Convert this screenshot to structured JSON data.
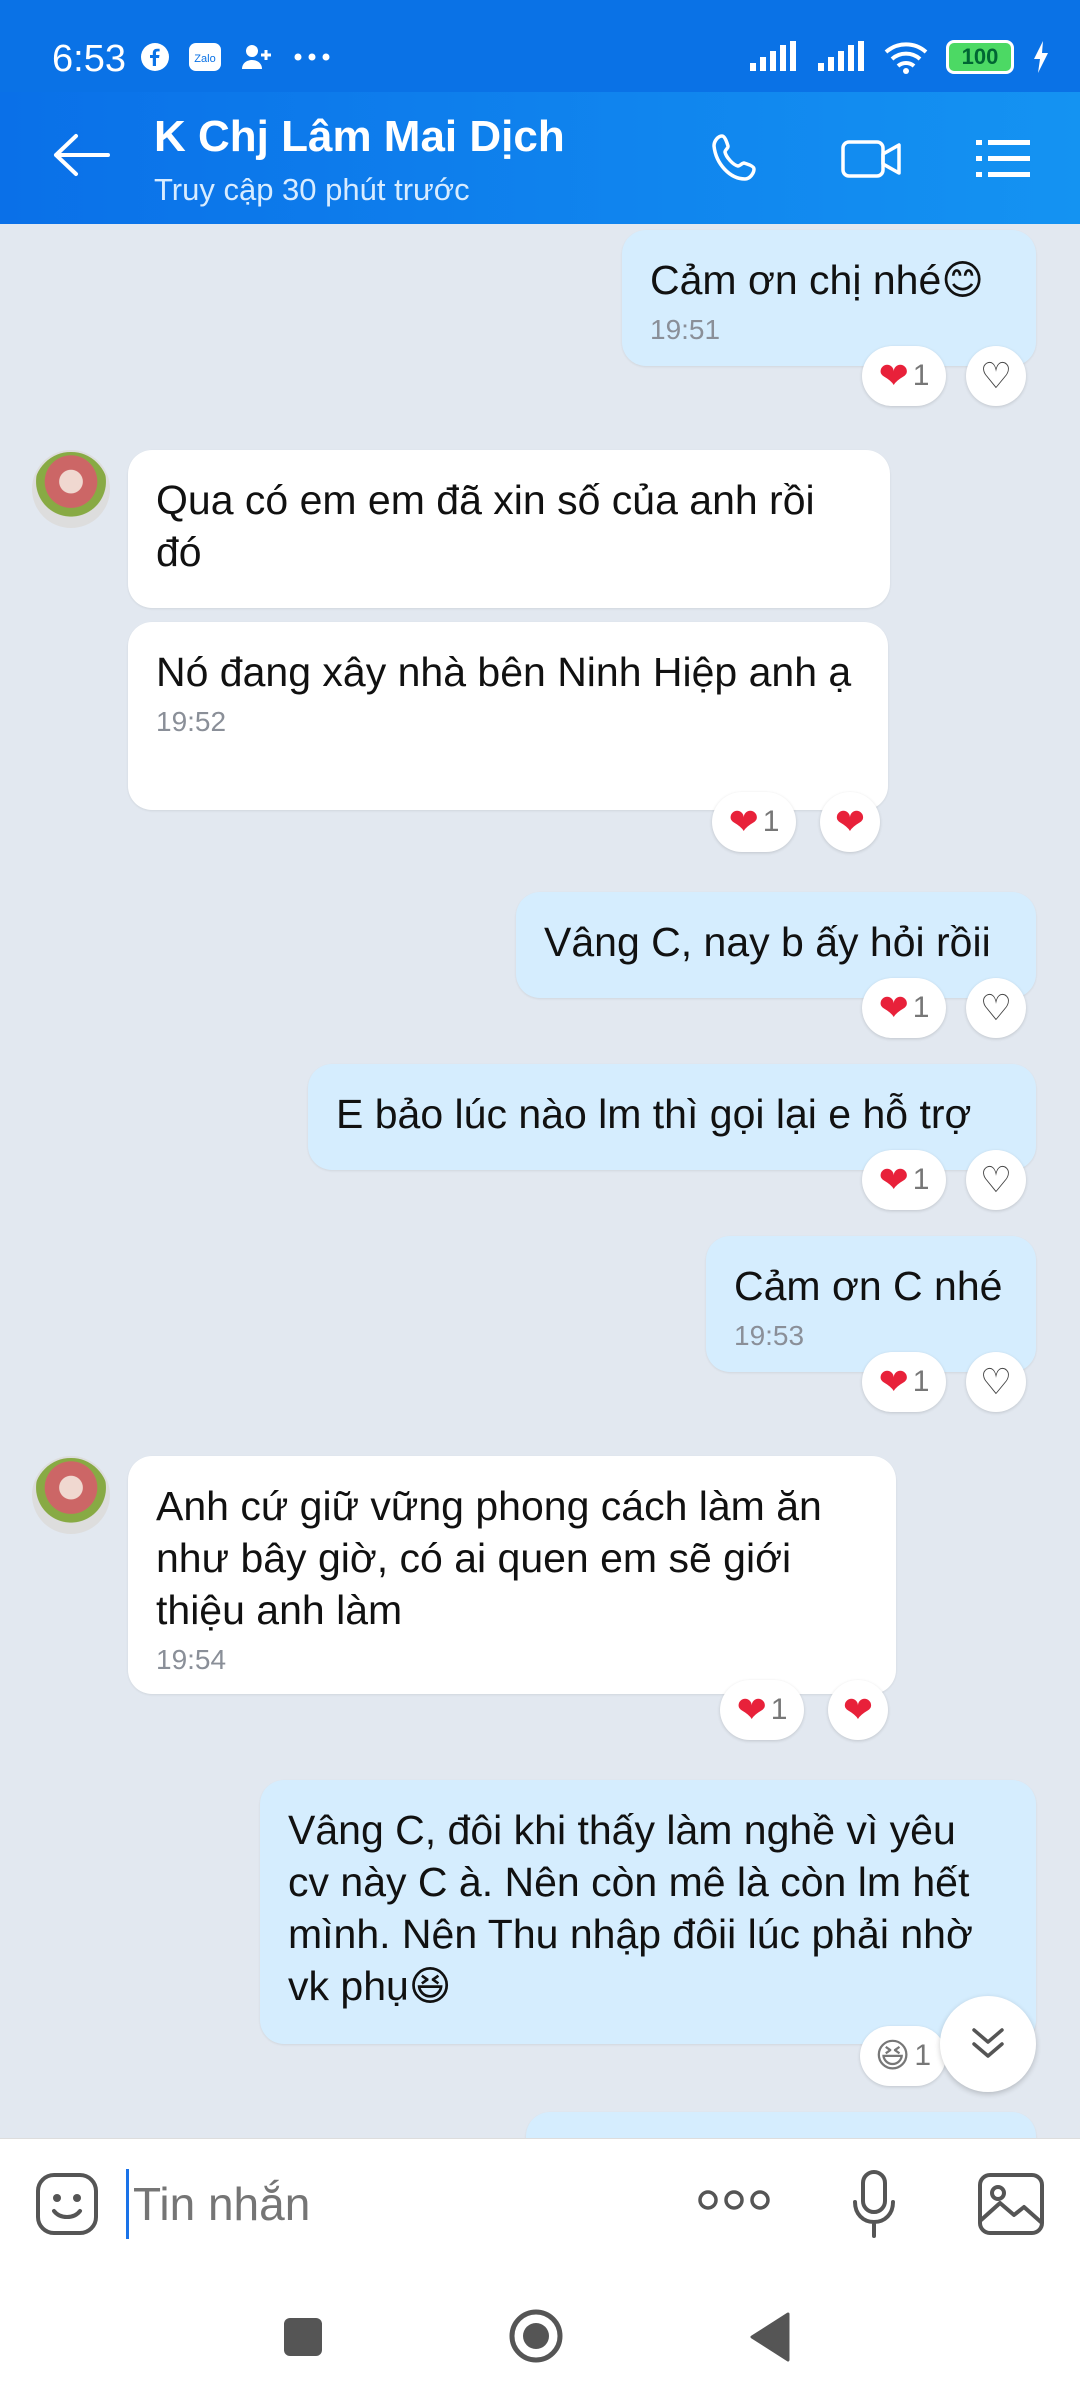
{
  "status": {
    "time": "6:53",
    "battery": "100"
  },
  "header": {
    "title": "K Chj Lâm Mai Dịch",
    "subtitle": "Truy cập 30 phút trước"
  },
  "messages": [
    {
      "text": "Cảm ơn chị nhé😊",
      "time": "19:51"
    },
    {
      "text": "Qua có em em đã xin số của anh rồi đó"
    },
    {
      "text": "Nó đang xây nhà bên Ninh Hiệp anh ạ",
      "time": "19:52"
    },
    {
      "text": "Vâng C, nay b ấy hỏi rồii"
    },
    {
      "text": "E bảo lúc nào lm thì gọi lại e hỗ trợ"
    },
    {
      "text": "Cảm ơn C nhé",
      "time": "19:53"
    },
    {
      "text": "Anh cứ giữ vững phong cách làm ăn như bây giờ, có ai quen em sẽ giới thiệu anh làm",
      "time": "19:54"
    },
    {
      "text": "Vâng C, đôi khi thấy làm nghề vì yêu cv này C à. Nên còn mê là còn lm hết mình. Nên Thu nhập đôii lúc phải nhờ vk phụ😆"
    }
  ],
  "reactions": {
    "count": "1",
    "laugh_count": "1"
  },
  "input": {
    "placeholder": "Tin nhắn"
  },
  "colors": {
    "header": "#0a72e6",
    "outgoing": "#d5edfe",
    "incoming": "#ffffff",
    "heart": "#e8213a"
  }
}
